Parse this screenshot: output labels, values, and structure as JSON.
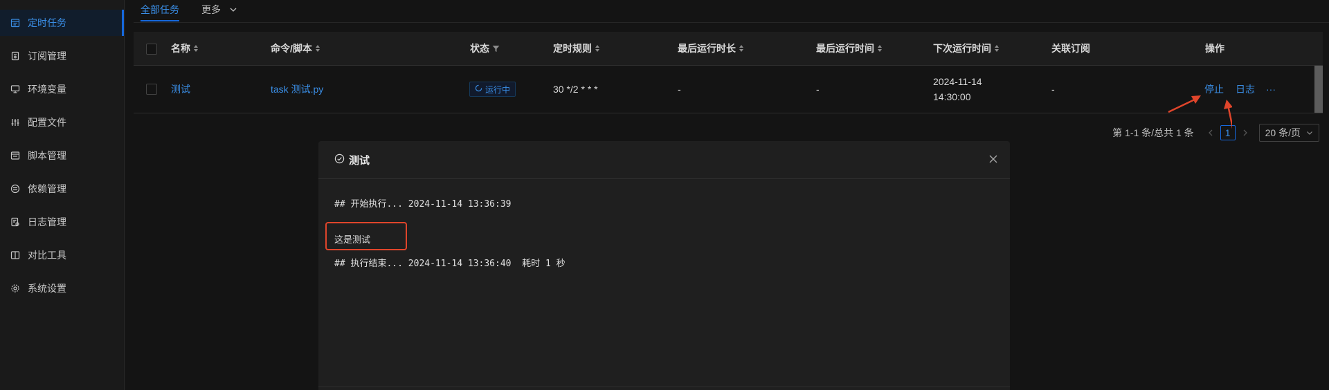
{
  "sidebar": {
    "items": [
      {
        "label": "定时任务",
        "icon": "calendar-icon",
        "active": true
      },
      {
        "label": "订阅管理",
        "icon": "subscription-icon",
        "active": false
      },
      {
        "label": "环境变量",
        "icon": "monitor-icon",
        "active": false
      },
      {
        "label": "配置文件",
        "icon": "sliders-icon",
        "active": false
      },
      {
        "label": "脚本管理",
        "icon": "script-icon",
        "active": false
      },
      {
        "label": "依赖管理",
        "icon": "package-icon",
        "active": false
      },
      {
        "label": "日志管理",
        "icon": "log-icon",
        "active": false
      },
      {
        "label": "对比工具",
        "icon": "compare-icon",
        "active": false
      },
      {
        "label": "系统设置",
        "icon": "gear-icon",
        "active": false
      }
    ]
  },
  "tabs": {
    "all": "全部任务",
    "more": "更多"
  },
  "table": {
    "headers": {
      "name": "名称",
      "command": "命令/脚本",
      "status": "状态",
      "schedule": "定时规则",
      "last_duration": "最后运行时长",
      "last_run": "最后运行时间",
      "next_run": "下次运行时间",
      "subscription": "关联订阅",
      "actions": "操作"
    },
    "rows": [
      {
        "name": "测试",
        "command": "task 测试.py",
        "status": "运行中",
        "schedule": "30 */2 * * *",
        "last_duration": "-",
        "last_run": "-",
        "next_run_date": "2024-11-14",
        "next_run_time": "14:30:00",
        "subscription": "-",
        "action_stop": "停止",
        "action_log": "日志",
        "action_more": "···"
      }
    ]
  },
  "pagination": {
    "summary": "第 1-1 条/总共 1 条",
    "current": "1",
    "page_size": "20 条/页"
  },
  "modal": {
    "title": "测试",
    "log_lines": [
      "## 开始执行... 2024-11-14 13:36:39",
      "这是测试",
      "## 执行结束... 2024-11-14 13:36:40  耗时 1 秒"
    ]
  },
  "colors": {
    "accent": "#3a8ee6",
    "annotation": "#e0452b"
  }
}
